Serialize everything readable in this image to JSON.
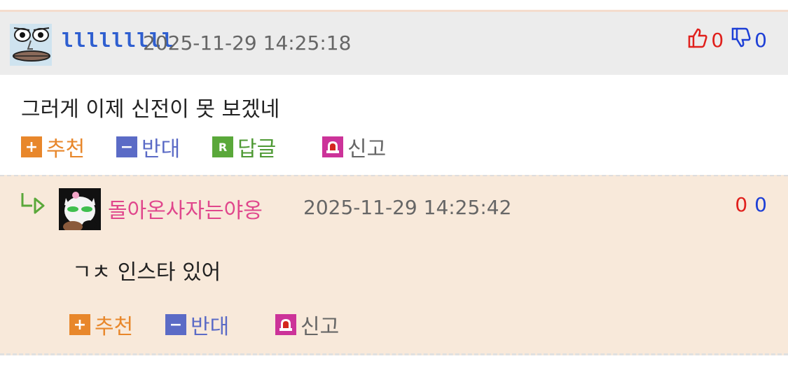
{
  "comment": {
    "nickname": "lllllllll",
    "datetime": "2025-11-29 14:25:18",
    "up_count": "0",
    "down_count": "0",
    "text": "그러게 이제 신전이 못 보겠네",
    "actions": {
      "recommend": "추천",
      "oppose": "반대",
      "reply": "답글",
      "report": "신고"
    },
    "icons": {
      "recommend": "plus-square-icon",
      "oppose": "minus-square-icon",
      "reply": "r-square-icon",
      "report": "siren-icon",
      "up": "thumbs-up-icon",
      "down": "thumbs-down-icon"
    }
  },
  "reply": {
    "nickname": "돌아온사자는야옹",
    "datetime": "2025-11-29 14:25:42",
    "up_count": "0",
    "down_count": "0",
    "text": "ㄱㅊ 인스타 있어",
    "actions": {
      "recommend": "추천",
      "oppose": "반대",
      "report": "신고"
    }
  },
  "colors": {
    "recommend": "#e8872b",
    "oppose": "#5b6bc6",
    "reply": "#4f9a35",
    "report": "#cc3399",
    "up": "#e0201c",
    "down": "#1d3fd6",
    "nick_reply": "#e0468c"
  }
}
